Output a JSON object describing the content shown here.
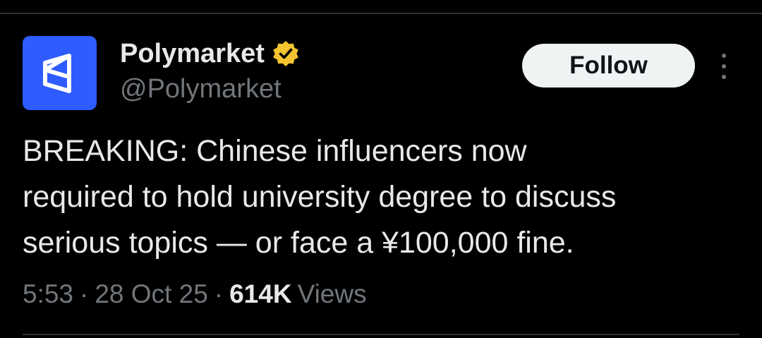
{
  "author": {
    "display_name": "Polymarket",
    "handle": "@Polymarket",
    "avatar_icon": "polymarket-logo-icon",
    "avatar_color": "#2e5cff",
    "verified_icon": "verified-gold-badge-icon",
    "verified_color": "#f4c430"
  },
  "actions": {
    "follow_label": "Follow",
    "more_icon": "more-vertical-icon"
  },
  "tweet": {
    "text": "BREAKING: Chinese influencers now\nrequired to hold university degree to discuss\nserious topics — or face a ¥100,000 fine."
  },
  "meta": {
    "time": "5:53",
    "separator": "·",
    "date": "28 Oct 25",
    "views_count": "614K",
    "views_label": "Views"
  },
  "colors": {
    "background": "#000000",
    "primary_text": "#e7e9ea",
    "secondary_text": "#71767b",
    "divider": "#2f3336",
    "follow_button_bg": "#eff3f4"
  }
}
